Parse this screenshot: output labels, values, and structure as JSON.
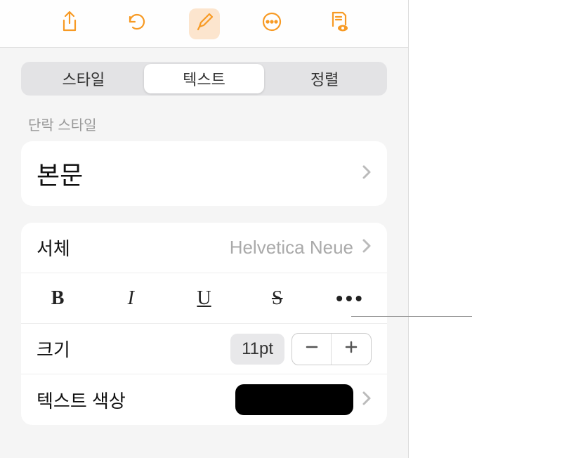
{
  "toolbar": {
    "icons": [
      "share",
      "undo",
      "format",
      "more",
      "document"
    ]
  },
  "tabs": {
    "items": [
      {
        "label": "스타일",
        "active": false
      },
      {
        "label": "텍스트",
        "active": true
      },
      {
        "label": "정렬",
        "active": false
      }
    ]
  },
  "paragraph": {
    "section_label": "단락 스타일",
    "style_name": "본문"
  },
  "font": {
    "label": "서체",
    "value": "Helvetica Neue"
  },
  "styles": {
    "bold": "B",
    "italic": "I",
    "underline": "U",
    "strike": "S",
    "more": "•••"
  },
  "size": {
    "label": "크기",
    "value": "11pt"
  },
  "text_color": {
    "label": "텍스트 색상",
    "value": "#000000"
  }
}
